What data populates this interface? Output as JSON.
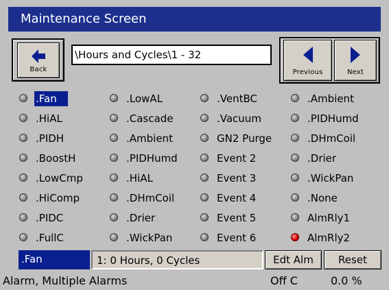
{
  "title": "Maintenance Screen",
  "back_label": "Back",
  "path": "\\Hours and Cycles\\1 - 32",
  "previous_label": "Previous",
  "next_label": "Next",
  "columns": [
    [
      ".Fan",
      ".HiAL",
      ".PIDH",
      ".BoostH",
      ".LowCmp",
      ".HiComp",
      ".PIDC",
      ".FullC"
    ],
    [
      ".LowAL",
      ".Cascade",
      ".Ambient",
      ".PIDHumd",
      ".HiAL",
      ".DHmCoil",
      ".Drier",
      ".WickPan"
    ],
    [
      ".VentBC",
      ".Vacuum",
      "GN2 Purge",
      "Event 2",
      "Event 3",
      "Event 4",
      "Event 5",
      "Event 6"
    ],
    [
      ".Ambient",
      ".PIDHumd",
      ".DHmCoil",
      ".Drier",
      ".WickPan",
      ".None",
      "AlmRly1",
      "AlmRly2"
    ]
  ],
  "selected_item": ".Fan",
  "selected_info": "1: 0 Hours, 0 Cycles",
  "edit_alarm_label": "Edt Alm",
  "reset_label": "Reset",
  "status_text": "Alarm, Multiple Alarms",
  "mode_text": "Off C",
  "percent_text": "0.0 %",
  "colors": {
    "title_bg": "#1c2f8d",
    "selection": "#0a1f8f",
    "led_off": "#8a8a8a",
    "led_on": "#e00000"
  }
}
